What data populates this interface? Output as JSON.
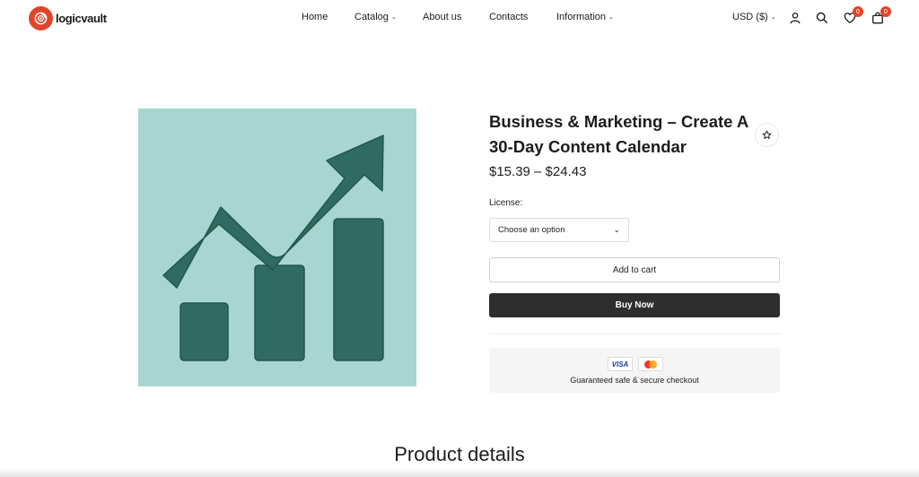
{
  "brand": {
    "name": "logicvault",
    "accent": "#e0452b"
  },
  "nav": {
    "items": [
      {
        "label": "Home",
        "dropdown": false
      },
      {
        "label": "Catalog",
        "dropdown": true
      },
      {
        "label": "About us",
        "dropdown": false
      },
      {
        "label": "Contacts",
        "dropdown": false
      },
      {
        "label": "Information",
        "dropdown": true
      }
    ],
    "currency": "USD ($)",
    "wishlist_count": "0",
    "cart_count": "0"
  },
  "product": {
    "title": "Business & Marketing – Create A 30-Day Content Calendar",
    "price": "$15.39 – $24.43",
    "license_label": "License:",
    "license_selected": "Choose an option",
    "add_to_cart": "Add to cart",
    "buy_now": "Buy Now",
    "payment_cards": [
      "VISA",
      "mastercard"
    ],
    "secure_text": "Guaranteed safe & secure checkout",
    "image_icon": "growth-chart-icon"
  },
  "section_title": "Product details"
}
